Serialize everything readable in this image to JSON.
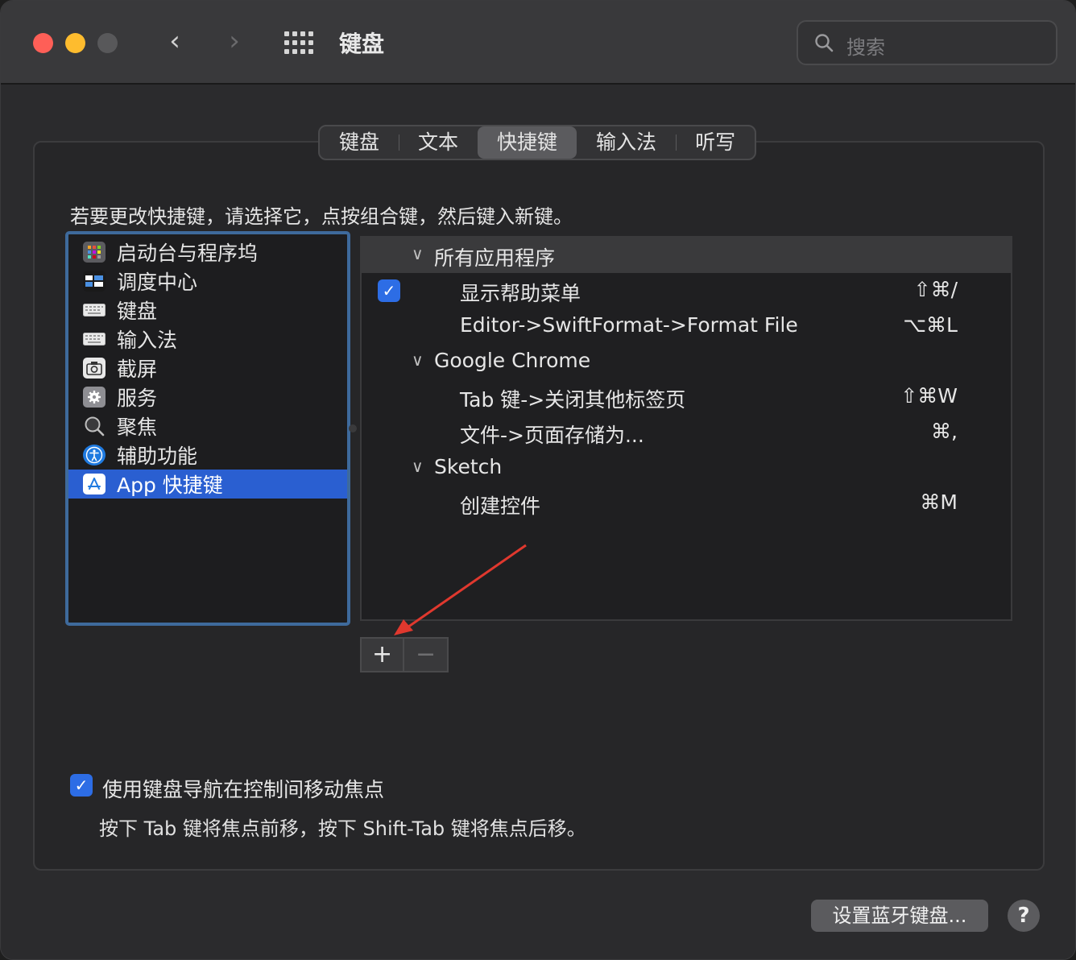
{
  "window": {
    "title": "键盘"
  },
  "search": {
    "placeholder": "搜索"
  },
  "tabs": [
    {
      "label": "键盘",
      "active": false
    },
    {
      "label": "文本",
      "active": false
    },
    {
      "label": "快捷键",
      "active": true
    },
    {
      "label": "输入法",
      "active": false
    },
    {
      "label": "听写",
      "active": false
    }
  ],
  "instruction": "若要更改快捷键，请选择它，点按组合键，然后键入新键。",
  "categories": [
    {
      "label": "启动台与程序坞",
      "icon": "launchpad-icon"
    },
    {
      "label": "调度中心",
      "icon": "mission-control-icon"
    },
    {
      "label": "键盘",
      "icon": "keyboard-icon"
    },
    {
      "label": "输入法",
      "icon": "input-source-icon"
    },
    {
      "label": "截屏",
      "icon": "screenshot-icon"
    },
    {
      "label": "服务",
      "icon": "services-gear-icon"
    },
    {
      "label": "聚焦",
      "icon": "spotlight-icon"
    },
    {
      "label": "辅助功能",
      "icon": "accessibility-icon"
    },
    {
      "label": "App 快捷键",
      "icon": "app-store-icon",
      "selected": true
    }
  ],
  "shortcuts": {
    "group_all": "所有应用程序",
    "all_1_name": "显示帮助菜单",
    "all_1_keys": "⇧⌘/",
    "all_2_name": "Editor->SwiftFormat->Format File",
    "all_2_keys": "⌥⌘L",
    "group_chrome": "Google Chrome",
    "chrome_1_name": "Tab 键->关闭其他标签页",
    "chrome_1_keys": "⇧⌘W",
    "chrome_2_name": "文件->页面存储为...",
    "chrome_2_keys": "⌘,",
    "group_sketch": "Sketch",
    "sketch_1_name": "创建控件",
    "sketch_1_keys": "⌘M"
  },
  "controls": {
    "add": "+",
    "remove": "−"
  },
  "keyboard_nav": {
    "label": "使用键盘导航在控制间移动焦点",
    "hint": "按下 Tab 键将焦点前移，按下 Shift-Tab 键将焦点后移。",
    "checked": true
  },
  "buttons": {
    "bluetooth": "设置蓝牙键盘...",
    "help": "?"
  },
  "colors": {
    "accent": "#2a5fd1",
    "checkbox": "#2d6de5",
    "annotation_arrow": "#e0382e"
  }
}
